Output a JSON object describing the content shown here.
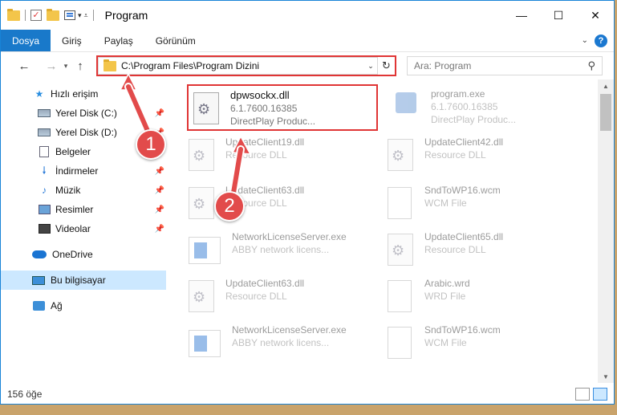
{
  "window": {
    "title": "Program"
  },
  "quick_access": {
    "dropdown": "▾"
  },
  "ribbon": {
    "tabs": [
      {
        "label": "Dosya"
      },
      {
        "label": "Giriş"
      },
      {
        "label": "Paylaş"
      },
      {
        "label": "Görünüm"
      }
    ]
  },
  "nav": {
    "address": "C:\\Program Files\\Program Dizini",
    "search_placeholder": "Ara: Program"
  },
  "sidebar": {
    "items": [
      {
        "label": "Hızlı erişim",
        "icon": "star-icon"
      },
      {
        "label": "Yerel Disk (C:)",
        "icon": "disk-icon",
        "pinned": true
      },
      {
        "label": "Yerel Disk (D:)",
        "icon": "disk-icon",
        "pinned": true
      },
      {
        "label": "Belgeler",
        "icon": "document-icon",
        "pinned": true
      },
      {
        "label": "İndirmeler",
        "icon": "download-icon",
        "pinned": true
      },
      {
        "label": "Müzik",
        "icon": "music-icon",
        "pinned": true
      },
      {
        "label": "Resimler",
        "icon": "pictures-icon",
        "pinned": true
      },
      {
        "label": "Videolar",
        "icon": "videos-icon",
        "pinned": true
      },
      {
        "label": "OneDrive",
        "icon": "cloud-icon"
      },
      {
        "label": "Bu bilgisayar",
        "icon": "computer-icon",
        "selected": true
      },
      {
        "label": "Ağ",
        "icon": "network-icon"
      }
    ]
  },
  "files": [
    {
      "name": "dpwsockx.dll",
      "line2": "6.1.7600.16385",
      "line3": "DirectPlay     Produc...",
      "icon": "dll-file-icon"
    },
    {
      "name": "program.exe",
      "line2": "6.1.7600.16385",
      "line3": "DirectPlay     Produc...",
      "icon": "exe-file-icon"
    },
    {
      "name": "UpdateClient19.dll",
      "line2": "Resource DLL",
      "icon": "dll-file-icon"
    },
    {
      "name": "UpdateClient42.dll",
      "line2": "Resource DLL",
      "icon": "dll-file-icon"
    },
    {
      "name": "UpdateClient63.dll",
      "line2": "Resource DLL",
      "icon": "dll-file-icon"
    },
    {
      "name": "SndToWP16.wcm",
      "line2": "WCM File",
      "icon": "generic-file-icon"
    },
    {
      "name": "NetworkLicenseServer.exe",
      "line2": "ABBY network licens...",
      "icon": "app-file-icon"
    },
    {
      "name": "UpdateClient65.dll",
      "line2": "Resource DLL",
      "icon": "dll-file-icon"
    },
    {
      "name": "UpdateClient63.dll",
      "line2": "Resource DLL",
      "icon": "dll-file-icon"
    },
    {
      "name": "Arabic.wrd",
      "line2": "WRD File",
      "icon": "generic-file-icon"
    },
    {
      "name": "NetworkLicenseServer.exe",
      "line2": "ABBY network licens...",
      "icon": "app-file-icon"
    },
    {
      "name": "SndToWP16.wcm",
      "line2": "WCM File",
      "icon": "generic-file-icon"
    }
  ],
  "status": {
    "count": "156 öğe"
  },
  "annotations": {
    "step1": "1",
    "step2": "2"
  },
  "colors": {
    "accent": "#1979ca",
    "highlight": "#e03535",
    "selection": "#cce8ff"
  }
}
